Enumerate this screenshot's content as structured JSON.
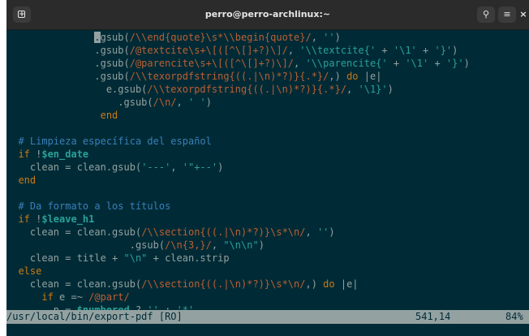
{
  "window": {
    "title": "perro@perro-archlinux:~"
  },
  "titlebar_buttons": {
    "new_tab_glyph": "+",
    "search_glyph": "⚲",
    "menu_glyph": "≡",
    "close_glyph": "×"
  },
  "editor": {
    "lines": [
      {
        "indent": "               ",
        "tokens": [
          {
            "t": ".",
            "c": "cursor"
          },
          {
            "t": "gsub(",
            "c": "df"
          },
          {
            "t": "/\\\\end{quote}\\s*\\\\begin{quote}/",
            "c": "rx"
          },
          {
            "t": ", ",
            "c": "df"
          },
          {
            "t": "''",
            "c": "st"
          },
          {
            "t": ")",
            "c": "df"
          }
        ]
      },
      {
        "indent": "               ",
        "tokens": [
          {
            "t": ".gsub(",
            "c": "df"
          },
          {
            "t": "/@textcite\\s+\\[([^\\[]+?)\\]/",
            "c": "rx"
          },
          {
            "t": ", ",
            "c": "df"
          },
          {
            "t": "'\\\\textcite{'",
            "c": "st"
          },
          {
            "t": " + ",
            "c": "df"
          },
          {
            "t": "'\\1'",
            "c": "st"
          },
          {
            "t": " + ",
            "c": "df"
          },
          {
            "t": "'}'",
            "c": "st"
          },
          {
            "t": ")",
            "c": "df"
          }
        ]
      },
      {
        "indent": "               ",
        "tokens": [
          {
            "t": ".gsub(",
            "c": "df"
          },
          {
            "t": "/@parencite\\s+\\[([^\\[]+?)\\]/",
            "c": "rx"
          },
          {
            "t": ", ",
            "c": "df"
          },
          {
            "t": "'\\\\parencite{'",
            "c": "st"
          },
          {
            "t": " + ",
            "c": "df"
          },
          {
            "t": "'\\1'",
            "c": "st"
          },
          {
            "t": " + ",
            "c": "df"
          },
          {
            "t": "'}'",
            "c": "st"
          },
          {
            "t": ")",
            "c": "df"
          }
        ]
      },
      {
        "indent": "               ",
        "tokens": [
          {
            "t": ".gsub(",
            "c": "df"
          },
          {
            "t": "/\\\\texorpdfstring{((.|\\n)*?)}{.*}/",
            "c": "rx"
          },
          {
            "t": ",) ",
            "c": "df"
          },
          {
            "t": "do",
            "c": "kw"
          },
          {
            "t": " |e|",
            "c": "df"
          }
        ]
      },
      {
        "indent": "                 ",
        "tokens": [
          {
            "t": "e.gsub(",
            "c": "df"
          },
          {
            "t": "/\\\\texorpdfstring{((.|\\n)*?)}{.*}/",
            "c": "rx"
          },
          {
            "t": ", ",
            "c": "df"
          },
          {
            "t": "'\\1}'",
            "c": "st"
          },
          {
            "t": ")",
            "c": "df"
          }
        ]
      },
      {
        "indent": "                   ",
        "tokens": [
          {
            "t": ".gsub(",
            "c": "df"
          },
          {
            "t": "/\\n/",
            "c": "rx"
          },
          {
            "t": ", ",
            "c": "df"
          },
          {
            "t": "' '",
            "c": "st"
          },
          {
            "t": ")",
            "c": "df"
          }
        ]
      },
      {
        "indent": "                ",
        "tokens": [
          {
            "t": "end",
            "c": "kw"
          }
        ]
      },
      {
        "indent": "",
        "tokens": []
      },
      {
        "indent": "  ",
        "tokens": [
          {
            "t": "# Limpieza específica del español",
            "c": "cm"
          }
        ]
      },
      {
        "indent": "  ",
        "tokens": [
          {
            "t": "if",
            "c": "kw"
          },
          {
            "t": " !",
            "c": "df"
          },
          {
            "t": "$en_date",
            "c": "iv"
          }
        ]
      },
      {
        "indent": "    ",
        "tokens": [
          {
            "t": "clean = clean.gsub(",
            "c": "df"
          },
          {
            "t": "'---'",
            "c": "st"
          },
          {
            "t": ", ",
            "c": "df"
          },
          {
            "t": "'\"+--'",
            "c": "st"
          },
          {
            "t": ")",
            "c": "df"
          }
        ]
      },
      {
        "indent": "  ",
        "tokens": [
          {
            "t": "end",
            "c": "kw"
          }
        ]
      },
      {
        "indent": "",
        "tokens": []
      },
      {
        "indent": "  ",
        "tokens": [
          {
            "t": "# Da formato a los títulos",
            "c": "cm"
          }
        ]
      },
      {
        "indent": "  ",
        "tokens": [
          {
            "t": "if",
            "c": "kw"
          },
          {
            "t": " !",
            "c": "df"
          },
          {
            "t": "$leave_h1",
            "c": "iv"
          }
        ]
      },
      {
        "indent": "    ",
        "tokens": [
          {
            "t": "clean = clean.gsub(",
            "c": "df"
          },
          {
            "t": "/\\\\section{((.|\\n)*?)}\\s*\\n/",
            "c": "rx"
          },
          {
            "t": ", ",
            "c": "df"
          },
          {
            "t": "''",
            "c": "st"
          },
          {
            "t": ")",
            "c": "df"
          }
        ]
      },
      {
        "indent": "                     ",
        "tokens": [
          {
            "t": ".gsub(",
            "c": "df"
          },
          {
            "t": "/\\n{3,}/",
            "c": "rx"
          },
          {
            "t": ", ",
            "c": "df"
          },
          {
            "t": "\"\\n\\n\"",
            "c": "st"
          },
          {
            "t": ")",
            "c": "df"
          }
        ]
      },
      {
        "indent": "    ",
        "tokens": [
          {
            "t": "clean = title + ",
            "c": "df"
          },
          {
            "t": "\"\\n\"",
            "c": "st"
          },
          {
            "t": " + clean.strip",
            "c": "df"
          }
        ]
      },
      {
        "indent": "  ",
        "tokens": [
          {
            "t": "else",
            "c": "kw"
          }
        ]
      },
      {
        "indent": "    ",
        "tokens": [
          {
            "t": "clean = clean.gsub(",
            "c": "df"
          },
          {
            "t": "/\\\\section{((.|\\n)*?)}\\s*\\n/",
            "c": "rx"
          },
          {
            "t": ",) ",
            "c": "df"
          },
          {
            "t": "do",
            "c": "kw"
          },
          {
            "t": " |e|",
            "c": "df"
          }
        ]
      },
      {
        "indent": "      ",
        "tokens": [
          {
            "t": "if",
            "c": "kw"
          },
          {
            "t": " e =~ ",
            "c": "df"
          },
          {
            "t": "/@part/",
            "c": "rx"
          }
        ]
      },
      {
        "indent": "        ",
        "tokens": [
          {
            "t": "n = ",
            "c": "df"
          },
          {
            "t": "$numbered",
            "c": "iv"
          },
          {
            "t": " ? ",
            "c": "df"
          },
          {
            "t": "''",
            "c": "st"
          },
          {
            "t": " : ",
            "c": "df"
          },
          {
            "t": "'*'",
            "c": "st"
          }
        ]
      }
    ]
  },
  "statusbar": {
    "file": "/usr/local/bin/export-pdf [RO]",
    "position": "541,14",
    "percent": "84%"
  }
}
